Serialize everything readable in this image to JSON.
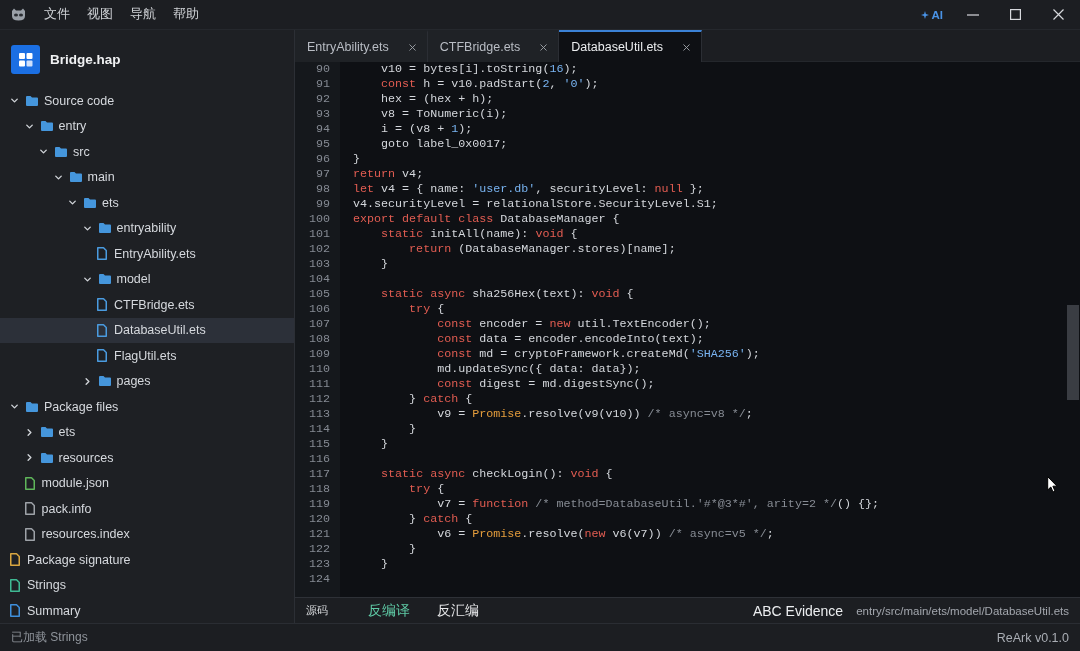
{
  "title_bar": {
    "menu": [
      "文件",
      "视图",
      "导航",
      "帮助"
    ],
    "ai_button": "AI"
  },
  "sidebar": {
    "project": "Bridge.hap",
    "tree": [
      {
        "name": "Source code",
        "kind": "folder",
        "expanded": true,
        "selected": false,
        "children": [
          {
            "name": "entry",
            "kind": "folder",
            "expanded": true,
            "selected": false,
            "children": [
              {
                "name": "src",
                "kind": "folder",
                "expanded": true,
                "selected": false,
                "children": [
                  {
                    "name": "main",
                    "kind": "folder",
                    "expanded": true,
                    "selected": false,
                    "children": [
                      {
                        "name": "ets",
                        "kind": "folder",
                        "expanded": true,
                        "selected": false,
                        "children": [
                          {
                            "name": "entryability",
                            "kind": "folder",
                            "expanded": true,
                            "selected": false,
                            "children": [
                              {
                                "name": "EntryAbility.ets",
                                "kind": "file",
                                "color": "#4a9be0",
                                "selected": false
                              }
                            ]
                          },
                          {
                            "name": "model",
                            "kind": "folder",
                            "expanded": true,
                            "selected": false,
                            "children": [
                              {
                                "name": "CTFBridge.ets",
                                "kind": "file",
                                "color": "#4a9be0",
                                "selected": false
                              },
                              {
                                "name": "DatabaseUtil.ets",
                                "kind": "file",
                                "color": "#4a9be0",
                                "selected": true
                              },
                              {
                                "name": "FlagUtil.ets",
                                "kind": "file",
                                "color": "#4a9be0",
                                "selected": false
                              }
                            ]
                          },
                          {
                            "name": "pages",
                            "kind": "folder",
                            "expanded": false,
                            "selected": false
                          }
                        ]
                      }
                    ]
                  }
                ]
              }
            ]
          }
        ]
      },
      {
        "name": "Package files",
        "kind": "folder",
        "expanded": true,
        "selected": false,
        "children": [
          {
            "name": "ets",
            "kind": "folder",
            "expanded": false,
            "selected": false
          },
          {
            "name": "resources",
            "kind": "folder",
            "expanded": false,
            "selected": false
          },
          {
            "name": "module.json",
            "kind": "file",
            "color": "#5fb65a",
            "selected": false
          },
          {
            "name": "pack.info",
            "kind": "file",
            "color": "#9ea2a8",
            "selected": false
          },
          {
            "name": "resources.index",
            "kind": "file",
            "color": "#9ea2a8",
            "selected": false
          }
        ]
      },
      {
        "name": "Package signature",
        "kind": "file",
        "color": "#d9a640",
        "selected": false
      },
      {
        "name": "Strings",
        "kind": "file",
        "color": "#3fb993",
        "selected": false
      },
      {
        "name": "Summary",
        "kind": "file",
        "color": "#3f8fdc",
        "selected": false
      }
    ]
  },
  "editor": {
    "tabs": [
      {
        "label": "EntryAbility.ets",
        "selected": false
      },
      {
        "label": "CTFBridge.ets",
        "selected": false
      },
      {
        "label": "DatabaseUtil.ets",
        "selected": true
      }
    ],
    "lines": [
      {
        "number": "90",
        "tokens": [
          {
            "text": "    v10 = bytes[i].toString(",
            "kind": "plain"
          },
          {
            "text": "16",
            "kind": "number"
          },
          {
            "text": ");",
            "kind": "plain"
          }
        ]
      },
      {
        "number": "91",
        "tokens": [
          {
            "text": "    const",
            "kind": "keyword"
          },
          {
            "text": " h = v10.padStart(",
            "kind": "plain"
          },
          {
            "text": "2",
            "kind": "number"
          },
          {
            "text": ", ",
            "kind": "plain"
          },
          {
            "text": "'0'",
            "kind": "string"
          },
          {
            "text": ");",
            "kind": "plain"
          }
        ]
      },
      {
        "number": "92",
        "tokens": [
          {
            "text": "    hex = (hex + h);",
            "kind": "plain"
          }
        ]
      },
      {
        "number": "93",
        "tokens": [
          {
            "text": "    v8 = ToNumeric(i);",
            "kind": "plain"
          }
        ]
      },
      {
        "number": "94",
        "tokens": [
          {
            "text": "    i = (v8 + ",
            "kind": "plain"
          },
          {
            "text": "1",
            "kind": "number"
          },
          {
            "text": ");",
            "kind": "plain"
          }
        ]
      },
      {
        "number": "95",
        "tokens": [
          {
            "text": "    goto label_0x0017;",
            "kind": "plain"
          }
        ]
      },
      {
        "number": "96",
        "tokens": [
          {
            "text": "}",
            "kind": "plain"
          }
        ]
      },
      {
        "number": "97",
        "tokens": [
          {
            "text": "return",
            "kind": "keyword"
          },
          {
            "text": " v4;",
            "kind": "plain"
          }
        ]
      },
      {
        "number": "98",
        "tokens": [
          {
            "text": "let",
            "kind": "keyword"
          },
          {
            "text": " v4 = { name: ",
            "kind": "plain"
          },
          {
            "text": "'user.db'",
            "kind": "string"
          },
          {
            "text": ", securityLevel: ",
            "kind": "plain"
          },
          {
            "text": "null",
            "kind": "keyword"
          },
          {
            "text": " };",
            "kind": "plain"
          }
        ]
      },
      {
        "number": "99",
        "tokens": [
          {
            "text": "v4.securityLevel = relationalStore.SecurityLevel.S1;",
            "kind": "plain"
          }
        ]
      },
      {
        "number": "100",
        "tokens": [
          {
            "text": "export",
            "kind": "keyword"
          },
          {
            "text": " default",
            "kind": "keyword"
          },
          {
            "text": " class",
            "kind": "keyword"
          },
          {
            "text": " DatabaseManager {",
            "kind": "plain"
          }
        ]
      },
      {
        "number": "101",
        "tokens": [
          {
            "text": "    static",
            "kind": "keyword"
          },
          {
            "text": " initAll(name): ",
            "kind": "plain"
          },
          {
            "text": "void",
            "kind": "keyword"
          },
          {
            "text": " {",
            "kind": "plain"
          }
        ]
      },
      {
        "number": "102",
        "tokens": [
          {
            "text": "        return",
            "kind": "keyword"
          },
          {
            "text": " (DatabaseManager.stores)[name];",
            "kind": "plain"
          }
        ]
      },
      {
        "number": "103",
        "tokens": [
          {
            "text": "    }",
            "kind": "plain"
          }
        ]
      },
      {
        "number": "104"
      },
      {
        "number": "105",
        "tokens": [
          {
            "text": "    static",
            "kind": "keyword"
          },
          {
            "text": " async",
            "kind": "keyword"
          },
          {
            "text": " sha256Hex(text): ",
            "kind": "plain"
          },
          {
            "text": "void",
            "kind": "keyword"
          },
          {
            "text": " {",
            "kind": "plain"
          }
        ]
      },
      {
        "number": "106",
        "tokens": [
          {
            "text": "        try",
            "kind": "keyword"
          },
          {
            "text": " {",
            "kind": "plain"
          }
        ]
      },
      {
        "number": "107",
        "tokens": [
          {
            "text": "            const",
            "kind": "keyword"
          },
          {
            "text": " encoder = ",
            "kind": "plain"
          },
          {
            "text": "new",
            "kind": "keyword"
          },
          {
            "text": " util.TextEncoder();",
            "kind": "plain"
          }
        ]
      },
      {
        "number": "108",
        "tokens": [
          {
            "text": "            const",
            "kind": "keyword"
          },
          {
            "text": " data = encoder.encodeInto(text);",
            "kind": "plain"
          }
        ]
      },
      {
        "number": "109",
        "tokens": [
          {
            "text": "            const",
            "kind": "keyword"
          },
          {
            "text": " md = cryptoFramework.createMd(",
            "kind": "plain"
          },
          {
            "text": "'SHA256'",
            "kind": "string"
          },
          {
            "text": ");",
            "kind": "plain"
          }
        ]
      },
      {
        "number": "110",
        "tokens": [
          {
            "text": "            md.updateSync({ data: data});",
            "kind": "plain"
          }
        ]
      },
      {
        "number": "111",
        "tokens": [
          {
            "text": "            const",
            "kind": "keyword"
          },
          {
            "text": " digest = md.digestSync();",
            "kind": "plain"
          }
        ]
      },
      {
        "number": "112",
        "tokens": [
          {
            "text": "        } ",
            "kind": "plain"
          },
          {
            "text": "catch",
            "kind": "keyword"
          },
          {
            "text": " {",
            "kind": "plain"
          }
        ]
      },
      {
        "number": "113",
        "tokens": [
          {
            "text": "            v9 = ",
            "kind": "plain"
          },
          {
            "text": "Promise",
            "kind": "type"
          },
          {
            "text": ".resolve(v9(v10)) ",
            "kind": "plain"
          },
          {
            "text": "/* async=v8 */",
            "kind": "comment"
          },
          {
            "text": ";",
            "kind": "plain"
          }
        ]
      },
      {
        "number": "114",
        "tokens": [
          {
            "text": "        }",
            "kind": "plain"
          }
        ]
      },
      {
        "number": "115",
        "tokens": [
          {
            "text": "    }",
            "kind": "plain"
          }
        ]
      },
      {
        "number": "116"
      },
      {
        "number": "117",
        "tokens": [
          {
            "text": "    static",
            "kind": "keyword"
          },
          {
            "text": " async",
            "kind": "keyword"
          },
          {
            "text": " checkLogin(): ",
            "kind": "plain"
          },
          {
            "text": "void",
            "kind": "keyword"
          },
          {
            "text": " {",
            "kind": "plain"
          }
        ]
      },
      {
        "number": "118",
        "tokens": [
          {
            "text": "        try",
            "kind": "keyword"
          },
          {
            "text": " {",
            "kind": "plain"
          }
        ]
      },
      {
        "number": "119",
        "tokens": [
          {
            "text": "            v7 = ",
            "kind": "plain"
          },
          {
            "text": "function",
            "kind": "keyword"
          },
          {
            "text": " /* method=DatabaseUtil.'#*@3*#', arity=2 */",
            "kind": "comment"
          },
          {
            "text": "() {};",
            "kind": "plain"
          }
        ]
      },
      {
        "number": "120",
        "tokens": [
          {
            "text": "        } ",
            "kind": "plain"
          },
          {
            "text": "catch",
            "kind": "keyword"
          },
          {
            "text": " {",
            "kind": "plain"
          }
        ]
      },
      {
        "number": "121",
        "tokens": [
          {
            "text": "            v6 = ",
            "kind": "plain"
          },
          {
            "text": "Promise",
            "kind": "type"
          },
          {
            "text": ".resolve(",
            "kind": "plain"
          },
          {
            "text": "new",
            "kind": "keyword"
          },
          {
            "text": " v6(v7)) ",
            "kind": "plain"
          },
          {
            "text": "/* async=v5 */",
            "kind": "comment"
          },
          {
            "text": ";",
            "kind": "plain"
          }
        ]
      },
      {
        "number": "122",
        "tokens": [
          {
            "text": "        }",
            "kind": "plain"
          }
        ]
      },
      {
        "number": "123",
        "tokens": [
          {
            "text": "    }",
            "kind": "plain"
          }
        ]
      },
      {
        "number": "124"
      }
    ],
    "source_button": "源码",
    "view_tabs": [
      {
        "label": "反编译",
        "selected": true
      },
      {
        "label": "反汇编",
        "selected": false
      }
    ],
    "evidence_label": "ABC Evidence",
    "file_path": "entry/src/main/ets/model/DatabaseUtil.ets"
  },
  "status_bar": {
    "message": "已加载 Strings",
    "version": "ReArk v0.1.0"
  }
}
